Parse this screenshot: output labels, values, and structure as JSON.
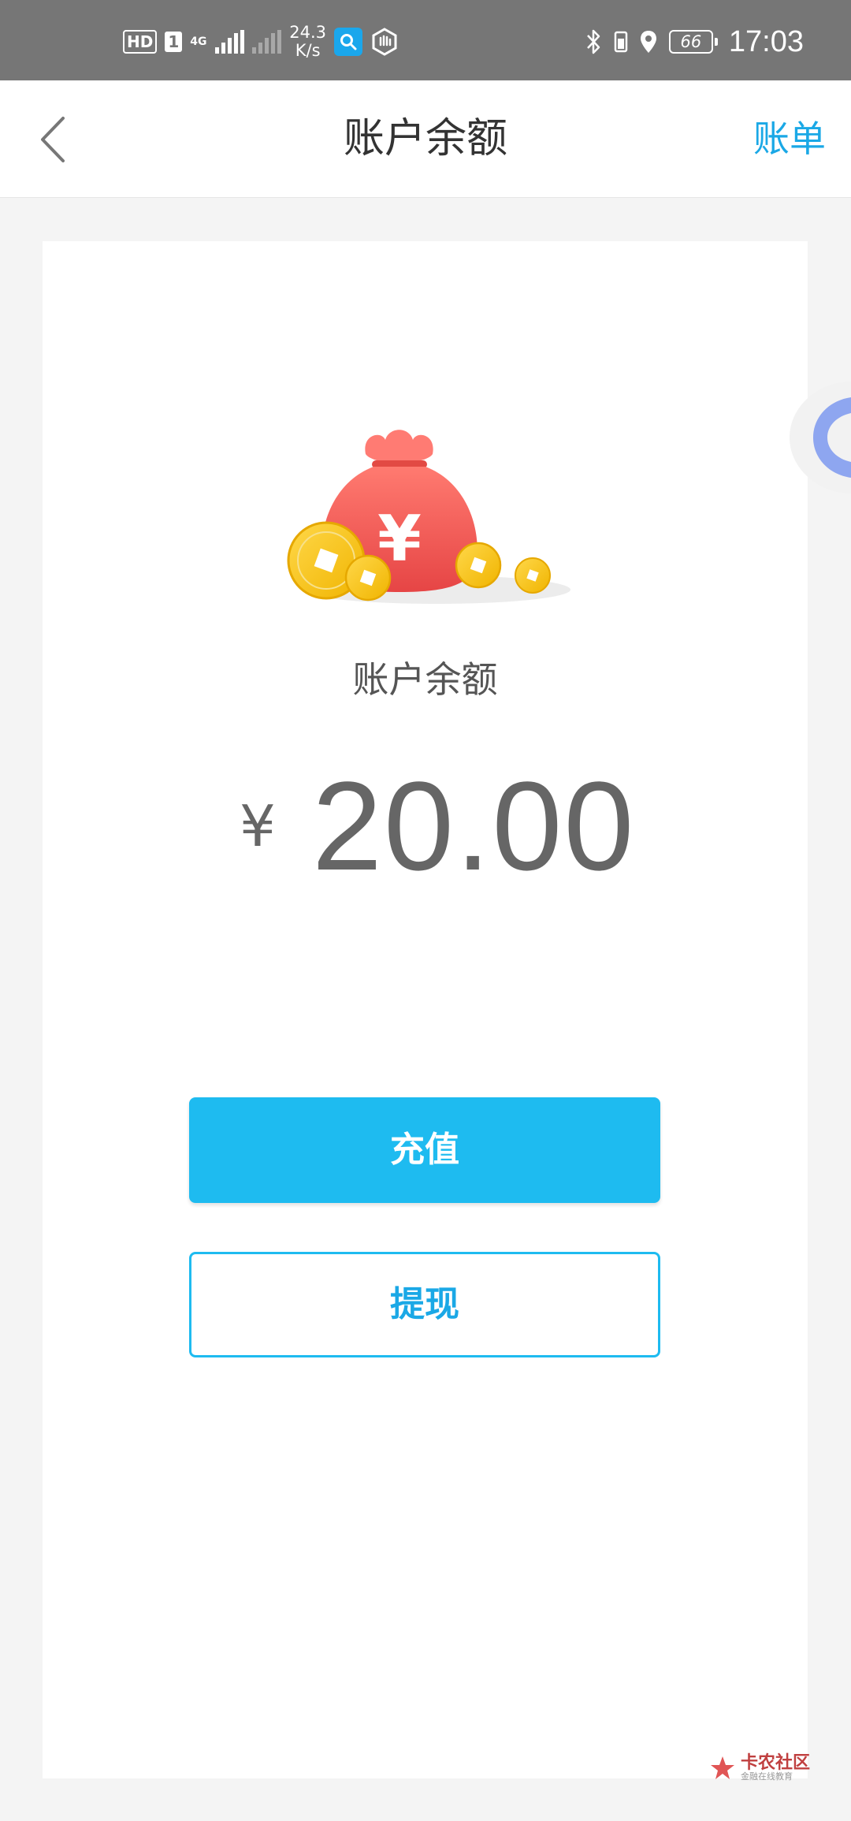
{
  "status_bar": {
    "hd": "HD",
    "sim": "1",
    "net_type": "4G",
    "speed_value": "24.3",
    "speed_unit": "K/s",
    "battery": "66",
    "time": "17:03"
  },
  "header": {
    "title": "账户余额",
    "right_link": "账单"
  },
  "balance": {
    "label": "账户余额",
    "currency": "¥",
    "amount": "20.00"
  },
  "actions": {
    "recharge": "充值",
    "withdraw": "提现"
  },
  "watermark": {
    "text": "卡农社区",
    "sub": "金融在线教育"
  },
  "colors": {
    "accent": "#1ebbf0",
    "link": "#1aa8e6",
    "status_bar": "#767676",
    "bag": "#f05a5a",
    "coin": "#f5c400"
  }
}
